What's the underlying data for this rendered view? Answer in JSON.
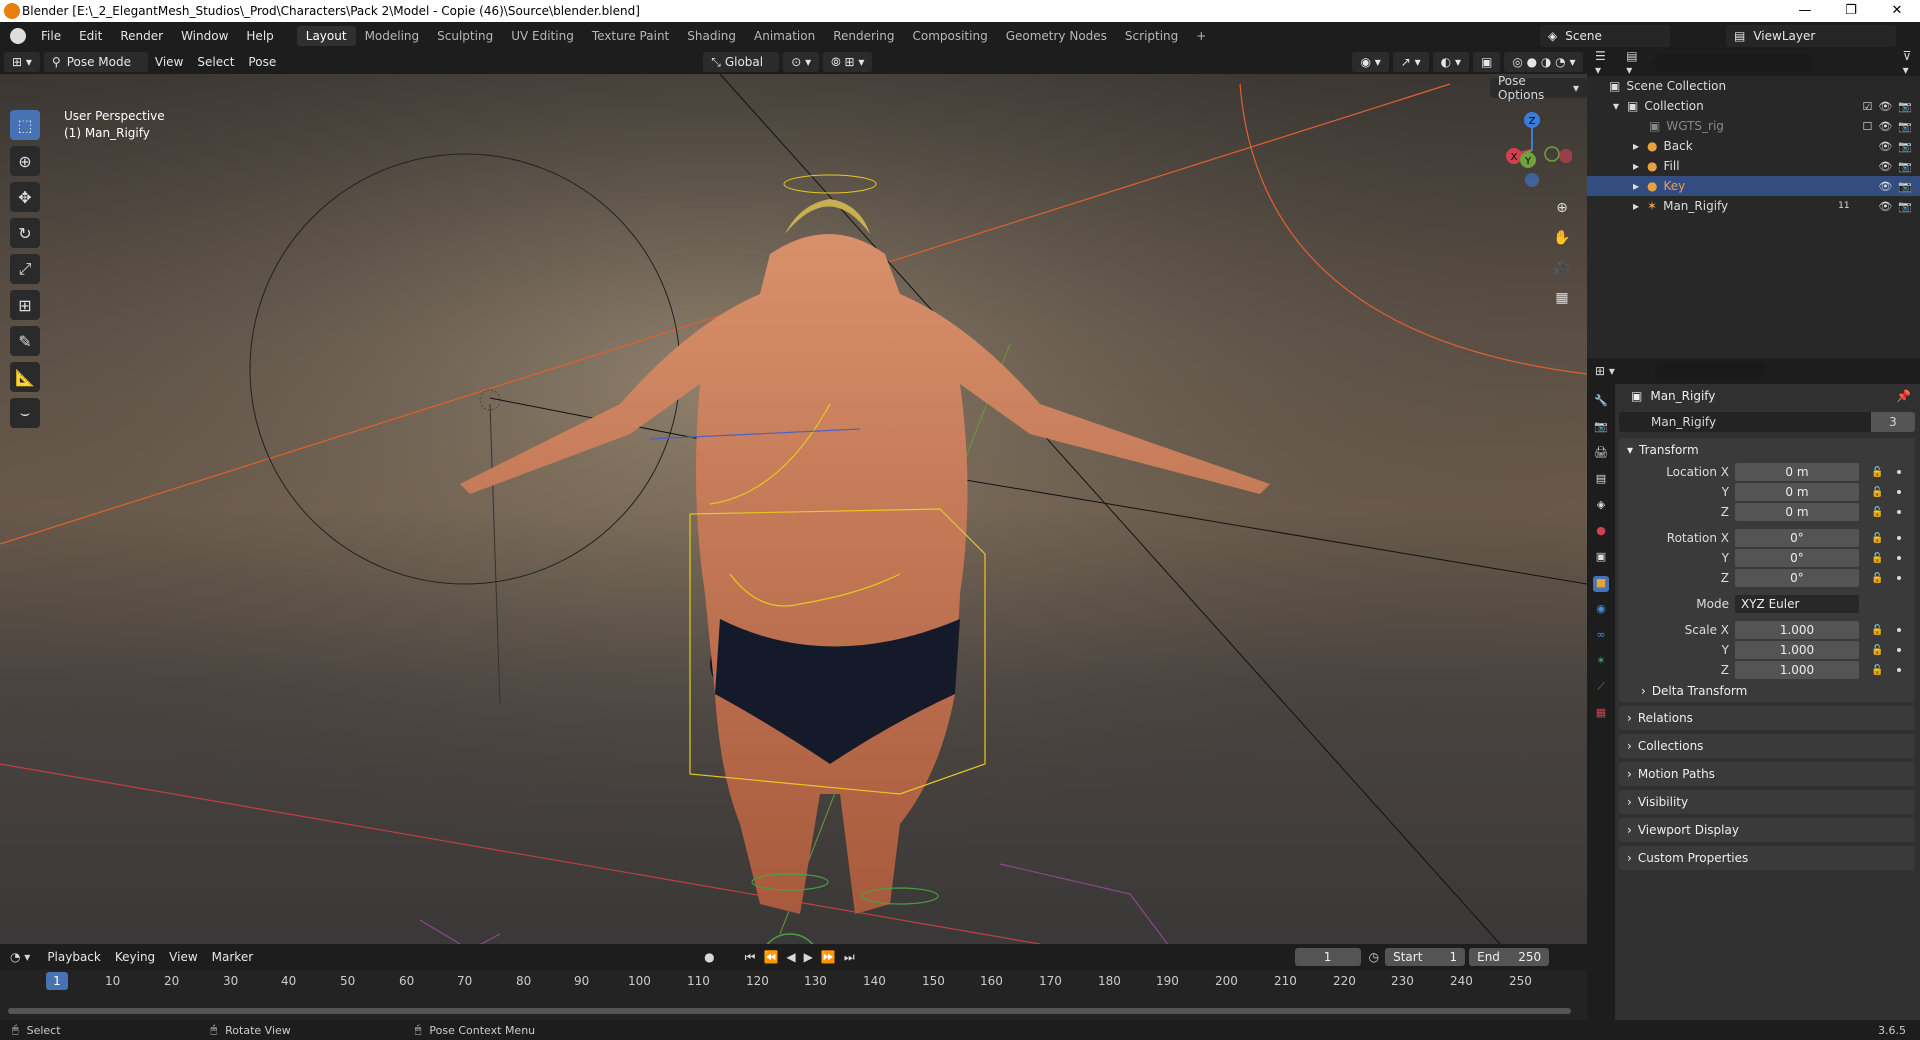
{
  "window": {
    "title": "Blender [E:\\_2_ElegantMesh_Studios\\_Prod\\Characters\\Pack 2\\Model - Copie (46)\\Source\\blender.blend]",
    "minimize": "—",
    "maximize": "❐",
    "close": "✕"
  },
  "menu": {
    "items": [
      "File",
      "Edit",
      "Render",
      "Window",
      "Help"
    ],
    "workspaces": [
      "Layout",
      "Modeling",
      "Sculpting",
      "UV Editing",
      "Texture Paint",
      "Shading",
      "Animation",
      "Rendering",
      "Compositing",
      "Geometry Nodes",
      "Scripting",
      "+"
    ],
    "scene": "Scene",
    "view_layer": "ViewLayer"
  },
  "viewport": {
    "mode": "Pose Mode",
    "menus": [
      "View",
      "Select",
      "Pose"
    ],
    "orientation": "Global",
    "info_line1": "User Perspective",
    "info_line2": "(1) Man_Rigify",
    "pose_options": "Pose Options",
    "gizmo": {
      "z": "Z",
      "y": "Y",
      "x": "X"
    }
  },
  "outliner": {
    "root": "Scene Collection",
    "collection": "Collection",
    "rows": [
      {
        "name": "WGTS_rig",
        "dim": true
      },
      {
        "name": "Back",
        "dim": false
      },
      {
        "name": "Fill",
        "dim": false
      },
      {
        "name": "Key",
        "dim": false,
        "selected": true
      },
      {
        "name": "Man_Rigify",
        "dim": false
      }
    ],
    "man_rigify_count": "11"
  },
  "properties": {
    "object_name": "Man_Rigify",
    "data_name": "Man_Rigify",
    "user_count": "3",
    "transform": {
      "header": "Transform",
      "location_label": "Location X",
      "rotation_label": "Rotation X",
      "scale_label": "Scale X",
      "y": "Y",
      "z": "Z",
      "location": [
        "0 m",
        "0 m",
        "0 m"
      ],
      "rotation": [
        "0°",
        "0°",
        "0°"
      ],
      "mode_label": "Mode",
      "mode": "XYZ Euler",
      "scale": [
        "1.000",
        "1.000",
        "1.000"
      ],
      "delta": "Delta Transform"
    },
    "panels": [
      "Relations",
      "Collections",
      "Motion Paths",
      "Visibility",
      "Viewport Display",
      "Custom Properties"
    ]
  },
  "timeline": {
    "menus": [
      "Playback",
      "Keying",
      "View",
      "Marker"
    ],
    "current_frame": "1",
    "start_label": "Start",
    "start": "1",
    "end_label": "End",
    "end": "250",
    "ruler": [
      "1",
      "10",
      "20",
      "30",
      "40",
      "50",
      "60",
      "70",
      "80",
      "90",
      "100",
      "110",
      "120",
      "130",
      "140",
      "150",
      "160",
      "170",
      "180",
      "190",
      "200",
      "210",
      "220",
      "230",
      "240",
      "250"
    ]
  },
  "status": {
    "select": "Select",
    "rotate": "Rotate View",
    "context": "Pose Context Menu",
    "version": "3.6.5"
  }
}
